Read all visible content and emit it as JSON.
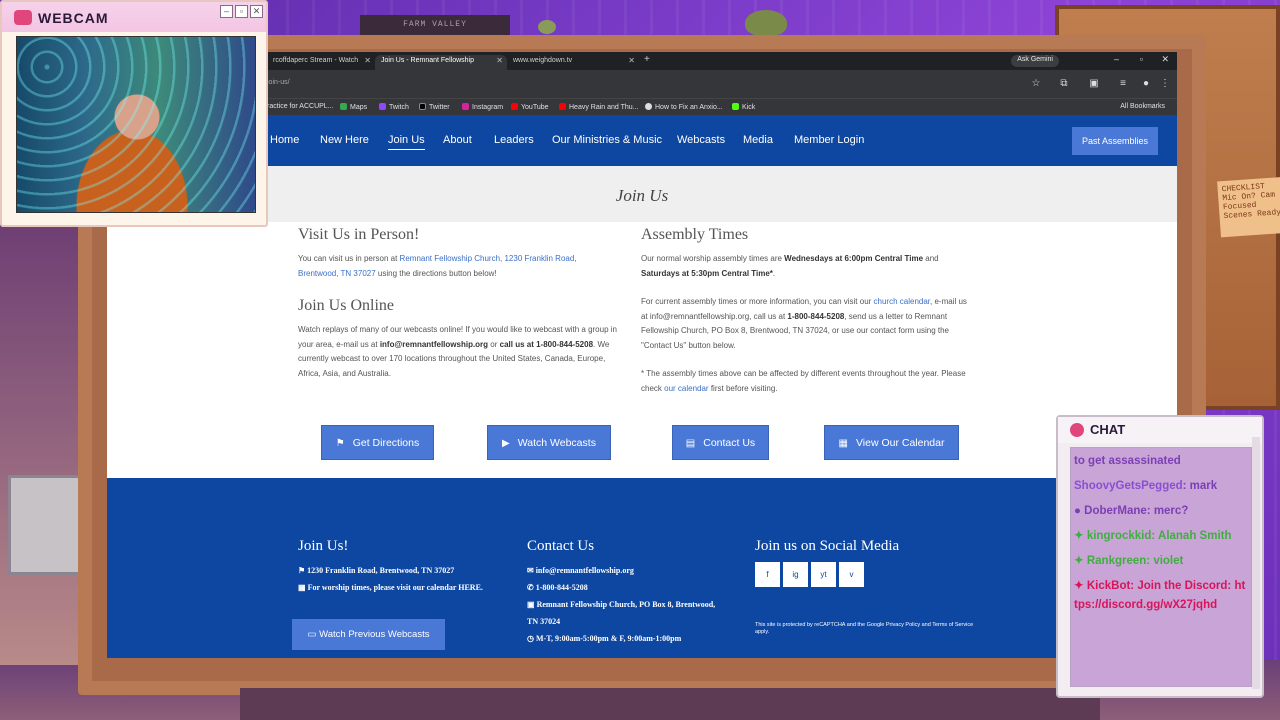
{
  "overlay": {
    "webcam_title": "WEBCAM",
    "chat_title": "CHAT",
    "chat_messages": [
      {
        "user": "",
        "text": "to get assassinated",
        "color": "#7b3fb5"
      },
      {
        "user": "ShoovyGetsPegged",
        "text": "mark",
        "color": "#8a4fcf"
      },
      {
        "user": "DoberMane",
        "text": "merc?",
        "color": "#8a4fcf"
      },
      {
        "user": "kingrockkid",
        "text": "Alanah Smith",
        "color": "#3fae3f"
      },
      {
        "user": "Rankgreen",
        "text": "violet",
        "color": "#3fae3f"
      },
      {
        "user": "KickBot",
        "text": "Join the Discord: https://discord.gg/wX27jqhd",
        "color": "#d8145a"
      }
    ],
    "decor_text": "FARM VALLEY",
    "note_text": "CHECKLIST Mic On? Cam Focused Scenes Ready"
  },
  "browser": {
    "tabs": [
      {
        "label": "rcoffdaperc Stream - Watch"
      },
      {
        "label": "Join Us - Remnant Fellowship"
      },
      {
        "label": "www.weighdown.tv"
      }
    ],
    "ask_gemini": "Ask Gemini",
    "url": "join-us/",
    "bookmarks": [
      "ractice for ACCUPL...",
      "Maps",
      "Twitch",
      "Twitter",
      "Instagram",
      "YouTube",
      "Heavy Rain and Thu...",
      "How to Fix an Anxio...",
      "Kick"
    ],
    "all_bookmarks": "All Bookmarks"
  },
  "site": {
    "nav": [
      "Home",
      "New Here",
      "Join Us",
      "About",
      "Leaders",
      "Our Ministries & Music",
      "Webcasts",
      "Media",
      "Member Login"
    ],
    "past_assemblies": "Past Assemblies",
    "hero_title": "Join Us",
    "visit": {
      "heading": "Visit Us in Person!",
      "p1": "You can visit us in person at ",
      "link": "Remnant Fellowship Church, 1230 Franklin Road, Brentwood, TN 37027",
      "p2": " using the directions button below!"
    },
    "online": {
      "heading": "Join Us Online",
      "p1": "Watch replays of many of our webcasts online! If you would like to webcast with a group in your area, e-mail us at ",
      "email": "info@remnantfellowship.org",
      "p2": " or ",
      "phone": "call us at 1-800-844-5208",
      "p3": ". We currently webcast to over 170 locations throughout the United States, Canada, Europe, Africa, Asia, and Australia."
    },
    "assembly": {
      "heading": "Assembly Times",
      "p1": "Our normal worship assembly times are ",
      "b1": "Wednesdays at 6:00pm Central Time",
      "p2": " and ",
      "b2": "Saturdays at 5:30pm Central Time*",
      "p3": ".",
      "q1": "For current assembly times or more information, you can visit our ",
      "q_link": "church calendar",
      "q2": ", e-mail us at info@remnantfellowship.org, call us at ",
      "q_phone": "1-800-844-5208",
      "q3": ", send us a letter to Remnant Fellowship Church, PO Box 8, Brentwood, TN 37024, or use our contact form using the \"Contact Us\" button below.",
      "n1": "* The assembly times above can be affected by different events throughout the year. Please check ",
      "n_link": "our calendar",
      "n2": " first before visiting."
    },
    "buttons": [
      "Get Directions",
      "Watch Webcasts",
      "Contact Us",
      "View Our Calendar"
    ],
    "footer": {
      "col1_heading": "Join Us!",
      "col1_addr": "1230 Franklin Road, Brentwood, TN 37027",
      "col1_cal": "For worship times, please visit our calendar HERE.",
      "col1_button": "Watch Previous Webcasts",
      "col2_heading": "Contact Us",
      "col2_email": "info@remnantfellowship.org",
      "col2_phone": "1-800-844-5208",
      "col2_addr": "Remnant Fellowship Church, PO Box 8, Brentwood, TN 37024",
      "col2_hours": "M-T, 9:00am-5:00pm & F, 9:00am-1:00pm",
      "col3_heading": "Join us on Social Media",
      "social": [
        "f",
        "ig",
        "yt",
        "v"
      ],
      "recaptcha": "This site is protected by reCAPTCHA and the Google Privacy Policy and Terms of Service apply."
    }
  }
}
